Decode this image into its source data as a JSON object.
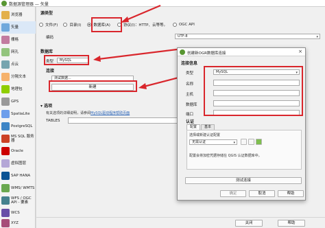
{
  "main_window": {
    "title": "数据源管理器 — 矢量"
  },
  "sidebar": {
    "items": [
      {
        "label": "浏览器",
        "icon": "folder-browser-icon",
        "color": "#e3b04b"
      },
      {
        "label": "矢量",
        "icon": "vector-icon",
        "color": "#6fa8dc"
      },
      {
        "label": "栅格",
        "icon": "raster-icon",
        "color": "#c27ba0"
      },
      {
        "label": "网孔",
        "icon": "mesh-icon",
        "color": "#93c47d"
      },
      {
        "label": "点云",
        "icon": "point-cloud-icon",
        "color": "#76a5af"
      },
      {
        "label": "分隔文本",
        "icon": "delimited-text-icon",
        "color": "#f6b26b"
      },
      {
        "label": "地理包",
        "icon": "geopackage-icon",
        "color": "#8fce00"
      },
      {
        "label": "GPS",
        "icon": "gps-icon",
        "color": "#999999"
      },
      {
        "label": "SpatiaLite",
        "icon": "spatialite-icon",
        "color": "#6d9eeb"
      },
      {
        "label": "PostgreSQL",
        "icon": "postgresql-icon",
        "color": "#3d85c6"
      },
      {
        "label": "MS SQL 服务器",
        "icon": "mssql-icon",
        "color": "#cc4125"
      },
      {
        "label": "Oracle",
        "icon": "oracle-icon",
        "color": "#cc0000"
      },
      {
        "label": "虚拟图层",
        "icon": "virtual-layer-icon",
        "color": "#b4a7d6"
      },
      {
        "label": "SAP HANA",
        "icon": "sap-hana-icon",
        "color": "#0b5394"
      },
      {
        "label": "WMS/ WMTS",
        "icon": "wms-icon",
        "color": "#6aa84f"
      },
      {
        "label": "WFS / OGC API - 要素",
        "icon": "wfs-icon",
        "color": "#45818e"
      },
      {
        "label": "WCS",
        "icon": "wcs-icon",
        "color": "#674ea7"
      },
      {
        "label": "XYZ",
        "icon": "xyz-icon",
        "color": "#a64d79"
      }
    ]
  },
  "source_type": {
    "title": "源类型",
    "options": [
      {
        "label": "文件(F)",
        "checked": false
      },
      {
        "label": "目录(I)",
        "checked": false
      },
      {
        "label": "数据库(A)",
        "checked": true
      },
      {
        "label": "协议(I)：HTTP、云等等。",
        "checked": false
      },
      {
        "label": "OGC API",
        "checked": false
      }
    ]
  },
  "encoding": {
    "label": "编码",
    "value": "UTF-8"
  },
  "database": {
    "title": "数据库",
    "type_label": "类型",
    "type_value": "MySQL",
    "connection_title": "连接",
    "connection_value": "测试数据...",
    "new_button": "新建"
  },
  "options": {
    "title": "选项",
    "help_text": "有关选项的详细说明，请参阅",
    "help_link": "MySQL驱动程序帮助页面",
    "tables_label": "TABLES"
  },
  "bottom": {
    "close_button": "关闭",
    "help_button": "帮助"
  },
  "dialog": {
    "title": "创建新OGR数据库连接",
    "section_title": "连接信息",
    "type_label": "类型",
    "type_value": "MySQL",
    "name_label": "名称",
    "host_label": "主机",
    "database_label": "数据库",
    "port_label": "端口",
    "auth_title": "认证",
    "tabs": [
      "配置",
      "基本"
    ],
    "auth_hint": "选择或新建认证配置",
    "auth_select": "无需认证",
    "auth_note": "配置会将加密凭据存储在 QGIS 认证数据库中。",
    "test_button": "测试连接",
    "ok_button": "确定",
    "cancel_button": "取消",
    "help_button": "帮助"
  },
  "colors": {
    "highlight": "#d9262c",
    "brand": "#589632"
  }
}
